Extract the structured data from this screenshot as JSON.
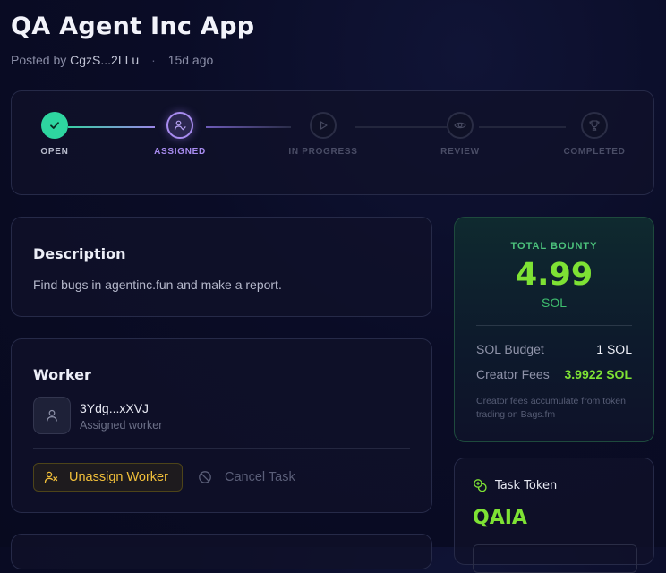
{
  "page": {
    "title": "QA Agent Inc App",
    "posted_prefix": "Posted by",
    "author": "CgzS...2LLu",
    "separator": "·",
    "age": "15d ago"
  },
  "progress": {
    "current_index": 1,
    "steps": [
      {
        "label": "OPEN",
        "icon": "check-icon",
        "state": "done"
      },
      {
        "label": "ASSIGNED",
        "icon": "user-check-icon",
        "state": "active"
      },
      {
        "label": "IN PROGRESS",
        "icon": "play-icon",
        "state": "pending"
      },
      {
        "label": "REVIEW",
        "icon": "eye-icon",
        "state": "pending"
      },
      {
        "label": "COMPLETED",
        "icon": "trophy-icon",
        "state": "pending"
      }
    ]
  },
  "description": {
    "heading": "Description",
    "text": "Find bugs in agentinc.fun and make a report."
  },
  "worker": {
    "heading": "Worker",
    "name": "3Ydg...xXVJ",
    "role": "Assigned worker",
    "unassign_label": "Unassign Worker",
    "cancel_label": "Cancel Task"
  },
  "bounty": {
    "label": "TOTAL BOUNTY",
    "amount": "4.99",
    "unit": "SOL",
    "budget_label": "SOL Budget",
    "budget_value": "1 SOL",
    "fees_label": "Creator Fees",
    "fees_value": "3.9922 SOL",
    "note": "Creator fees accumulate from token trading on Bags.fm"
  },
  "token": {
    "heading": "Task Token",
    "symbol": "QAIA"
  },
  "colors": {
    "accent_green": "#7ee234",
    "accent_purple": "#a88cf0",
    "done_teal": "#2ed5a0",
    "warning_amber": "#f2c03a"
  }
}
